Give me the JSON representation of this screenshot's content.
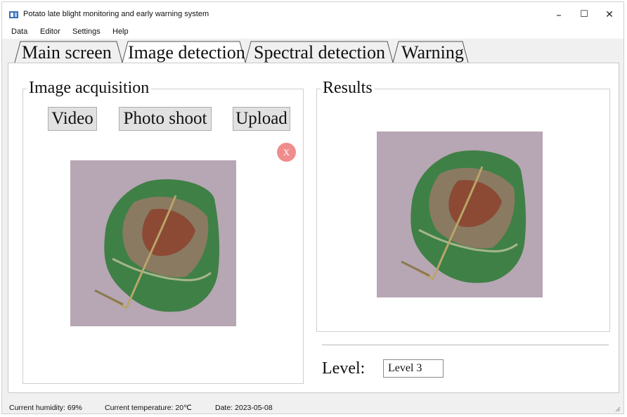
{
  "window": {
    "title": "Potato late blight monitoring and early warning system",
    "controls": {
      "minimize": "–",
      "maximize": "☐",
      "close": "✕"
    }
  },
  "menu": [
    "Data",
    "Editor",
    "Settings",
    "Help"
  ],
  "tabs": [
    "Main screen",
    "Image detection",
    "Spectral detection",
    "Warning"
  ],
  "active_tab": "Image detection",
  "acquisition": {
    "title": "Image acquisition",
    "buttons": {
      "video": "Video",
      "photo": "Photo shoot",
      "upload": "Upload"
    },
    "remove_label": "X"
  },
  "results": {
    "title": "Results",
    "level_label": "Level:",
    "level_value": "Level 3"
  },
  "status": {
    "humidity": "Current humidity: 69%",
    "temperature": "Current temperature: 20℃",
    "date": "Date: 2023-05-08"
  },
  "colors": {
    "window_bg": "#f0f0f0",
    "remove_button": "#f08c8c",
    "leaf_bg": "#b7a6b4"
  }
}
